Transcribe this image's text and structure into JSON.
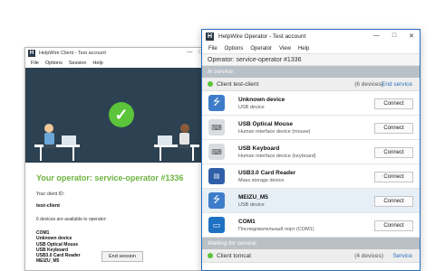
{
  "client_window": {
    "title": "HelpWire Client - Test account",
    "menu": [
      "File",
      "Options",
      "Session",
      "Help"
    ],
    "operator_heading": "Your operator: service-operator #1336",
    "client_id_label": "Your client ID:",
    "client_id": "test-client",
    "devices_available": "6 devices are available to operator:",
    "devices": [
      "COM1",
      "Unknown device",
      "USB Optical Mouse",
      "USB Keyboard",
      "USB3.0 Card Reader",
      "MEIZU_M5"
    ],
    "end_session_label": "End session"
  },
  "operator_window": {
    "title": "HelpWire Operator - Test account",
    "menu": [
      "File",
      "Options",
      "Operator",
      "View",
      "Help"
    ],
    "operator_line": "Operator: service-operator #1336",
    "in_service_label": "In service:",
    "client_in_service": {
      "label": "Client",
      "name": "test-client",
      "count": "(6 devices)",
      "action": "End service",
      "status_color": "#5bc43a"
    },
    "devices": [
      {
        "name": "Unknown device",
        "type": "USB device",
        "icon": "usb-icon",
        "button": "Connect"
      },
      {
        "name": "USB Optical Mouse",
        "type": "Human interface device (mouse)",
        "icon": "keyboard-icon",
        "button": "Connect"
      },
      {
        "name": "USB Keyboard",
        "type": "Human interface device (keyboard)",
        "icon": "keyboard-icon",
        "button": "Connect"
      },
      {
        "name": "USB3.0 Card Reader",
        "type": "Mass storage device",
        "icon": "card-reader-icon",
        "button": "Connect"
      },
      {
        "name": "MEIZU_M5",
        "type": "USB device",
        "icon": "usb-icon",
        "button": "Connect"
      },
      {
        "name": "COM1",
        "type": "Последовательный порт (COM1)",
        "icon": "serial-port-icon",
        "button": "Connect"
      }
    ],
    "waiting_label": "Waiting for service:",
    "client_waiting": {
      "label": "Client",
      "name": "tomcat",
      "count": "(4 devices)",
      "action": "Service",
      "status_color": "#5bc43a"
    }
  },
  "colors": {
    "accent": "#2a6ebb",
    "banner": "#2c4152",
    "success": "#5bc43a",
    "heading_green": "#6cb33f"
  }
}
